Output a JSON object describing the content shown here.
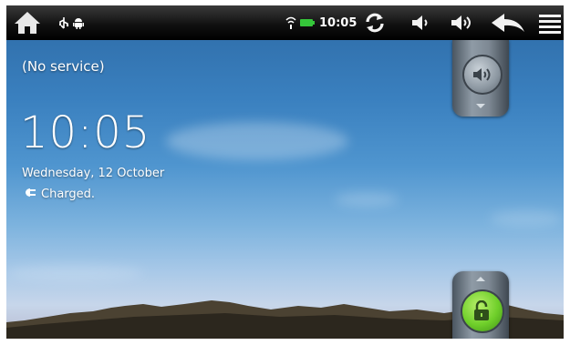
{
  "status_bar": {
    "home_icon": "home-icon",
    "usb_icon": "usb-icon",
    "android_debug_icon": "android-debug-icon",
    "wifi_icon": "wifi-icon",
    "battery_icon": "battery-charging-icon",
    "time": "10:05",
    "sync_icon": "sync-icon",
    "volume_down_icon": "volume-down-icon",
    "volume_up_icon": "volume-up-icon",
    "back_icon": "back-icon",
    "menu_icon": "menu-icon"
  },
  "lockscreen": {
    "carrier": "(No service)",
    "time": "10:05",
    "date": "Wednesday, 12 October",
    "charging_status": "Charged.",
    "sound_toggle_icon": "sound-on-icon",
    "unlock_icon": "unlock-icon"
  },
  "colors": {
    "statusbar": "#000000",
    "battery": "#35c63a",
    "unlock_green": "#6fcf2a",
    "sky_top": "#2d6aa5"
  }
}
